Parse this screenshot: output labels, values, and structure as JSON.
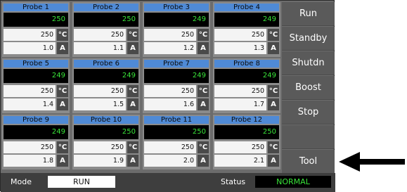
{
  "probes": [
    {
      "title": "Probe 1",
      "display": "250",
      "temp": "250",
      "amp": "1.0"
    },
    {
      "title": "Probe 2",
      "display": "250",
      "temp": "250",
      "amp": "1.1"
    },
    {
      "title": "Probe 3",
      "display": "249",
      "temp": "250",
      "amp": "1.2"
    },
    {
      "title": "Probe 4",
      "display": "249",
      "temp": "250",
      "amp": "1.3"
    },
    {
      "title": "Probe 5",
      "display": "249",
      "temp": "250",
      "amp": "1.4"
    },
    {
      "title": "Probe 6",
      "display": "249",
      "temp": "250",
      "amp": "1.5"
    },
    {
      "title": "Probe 7",
      "display": "249",
      "temp": "250",
      "amp": "1.6"
    },
    {
      "title": "Probe 8",
      "display": "249",
      "temp": "250",
      "amp": "1.7"
    },
    {
      "title": "Probe 9",
      "display": "249",
      "temp": "250",
      "amp": "1.8"
    },
    {
      "title": "Probe 10",
      "display": "250",
      "temp": "250",
      "amp": "1.9"
    },
    {
      "title": "Probe 11",
      "display": "250",
      "temp": "250",
      "amp": "2.0"
    },
    {
      "title": "Probe 12",
      "display": "250",
      "temp": "250",
      "amp": "2.1"
    }
  ],
  "units": {
    "temp": "°C",
    "amp": "A"
  },
  "side_buttons": [
    "Run",
    "Standby",
    "Shutdn",
    "Boost",
    "Stop",
    "",
    "Tool"
  ],
  "status_bar": {
    "mode_label": "Mode",
    "mode_value": "RUN",
    "status_label": "Status",
    "status_value": "NORMAL"
  },
  "colors": {
    "probe_header": "#4f8ad6",
    "display_text": "#39e639",
    "panel_bg": "#6c6c6c",
    "unit_badge": "#4a4a4a"
  },
  "icons": {
    "pointer": "arrow-left-icon"
  }
}
